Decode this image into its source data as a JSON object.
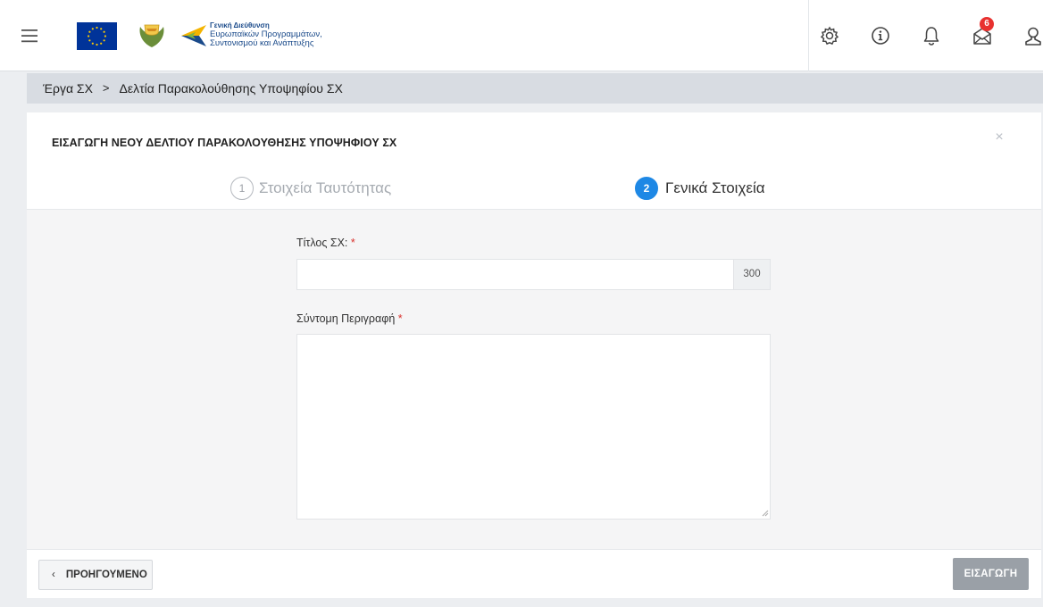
{
  "header": {
    "org_line1": "Γενική Διεύθυνση",
    "org_line2": "Ευρωπαϊκών Προγραμμάτων,",
    "org_line3": "Συντονισμού και Ανάπτυξης",
    "notification_count": "6",
    "icons": [
      "hamburger-menu-icon",
      "eu-flag-logo",
      "cyprus-emblem-logo",
      "directorate-logo",
      "gear-icon",
      "info-icon",
      "bell-icon",
      "envelope-icon",
      "user-icon"
    ],
    "brand_color": "#003399"
  },
  "breadcrumb": {
    "items": [
      "Έργα ΣΧ",
      "Δελτία Παρακολούθησης Υποψηφίου ΣΧ"
    ],
    "separator": ">"
  },
  "modal": {
    "title": "ΕΙΣΑΓΩΓΗ ΝΕΟΥ ΔΕΛΤΙΟΥ ΠΑΡΑΚΟΛΟΥΘΗΣΗΣ ΥΠΟΨΗΦΙΟΥ ΣΧ",
    "close_symbol": "×",
    "steps": [
      {
        "number": "1",
        "label": "Στοιχεία Ταυτότητας",
        "active": false
      },
      {
        "number": "2",
        "label": "Γενικά Στοιχεία",
        "active": true
      }
    ],
    "form": {
      "title_label": "Τίτλος ΣΧ:",
      "required_mark": "*",
      "title_value": "",
      "title_max_chars": "300",
      "description_label": "Σύντομη Περιγραφή",
      "description_value": ""
    },
    "buttons": {
      "prev_chevron": "‹",
      "prev_label": "ΠΡΟΗΓΟΥΜΕΝΟ",
      "submit_label": "ΕΙΣΑΓΩΓΗ"
    },
    "colors": {
      "active_step": "#1e88e5",
      "required": "#d9322e",
      "submit_disabled": "#9aa0a7"
    }
  }
}
